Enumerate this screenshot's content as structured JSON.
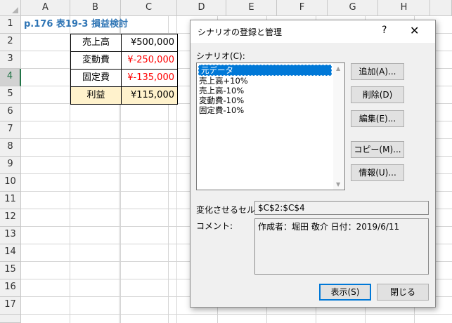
{
  "sheet": {
    "columns": [
      "A",
      "B",
      "C",
      "D",
      "E",
      "F",
      "G",
      "H"
    ],
    "rows": [
      "1",
      "2",
      "3",
      "4",
      "5",
      "6",
      "7",
      "8",
      "9",
      "10",
      "11",
      "12",
      "13",
      "14",
      "15",
      "16",
      "17"
    ],
    "title": "p.176 表19-3 損益検討",
    "table": [
      {
        "label": "売上高",
        "value": "¥500,000"
      },
      {
        "label": "変動費",
        "value": "¥-250,000"
      },
      {
        "label": "固定費",
        "value": "¥-135,000"
      },
      {
        "label": "利益",
        "value": "¥115,000"
      }
    ]
  },
  "dialog": {
    "title": "シナリオの登録と管理",
    "help": "?",
    "close": "✕",
    "list_label": "シナリオ(C):",
    "scenarios": [
      "元データ",
      "売上高+10%",
      "売上高-10%",
      "変動費-10%",
      "固定費-10%"
    ],
    "buttons": {
      "add": "追加(A)...",
      "delete": "削除(D)",
      "edit": "編集(E)...",
      "copy": "コピー(M)...",
      "info": "情報(U)...",
      "show": "表示(S)",
      "close": "閉じる"
    },
    "changing_cells_label": "変化させるセル:",
    "changing_cells": "$C$2:$C$4",
    "comment_label": "コメント:",
    "comment": "作成者：堀田 敬介 日付：2019/6/11"
  },
  "colors": {
    "title": "#2f75b5",
    "negative": "#ff0000",
    "highlight": "#fff2cc",
    "selection": "#0078d7"
  }
}
